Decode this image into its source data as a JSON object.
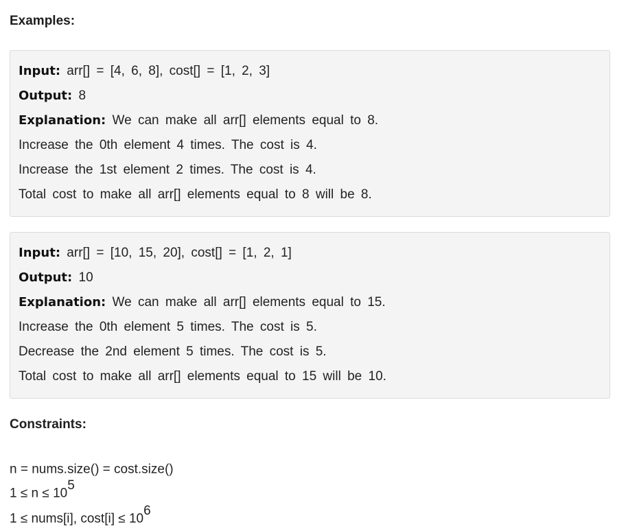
{
  "examples_heading": "Examples:",
  "examples": [
    {
      "input_label": "Input:",
      "input_value": "arr[] = [4, 6, 8], cost[] = [1, 2, 3]",
      "output_label": "Output:",
      "output_value": "8",
      "explanation_label": "Explanation:",
      "explanation_value": "We can make all arr[] elements equal to 8.",
      "details": [
        "Increase the 0th element 4 times. The cost is 4.",
        "Increase the 1st element 2 times. The cost is 4.",
        "Total cost to make all arr[] elements equal to 8 will be 8."
      ]
    },
    {
      "input_label": "Input:",
      "input_value": "arr[] = [10, 15, 20], cost[] = [1, 2, 1]",
      "output_label": "Output:",
      "output_value": "10",
      "explanation_label": "Explanation:",
      "explanation_value": "We can make all arr[] elements equal to 15.",
      "details": [
        "Increase the 0th element 5 times. The cost is 5.",
        "Decrease the 2nd element 5 times. The cost is 5.",
        "Total cost to make all arr[] elements equal to 15 will be 10."
      ]
    }
  ],
  "constraints_heading": "Constraints:",
  "constraints": [
    {
      "text": "n = nums.size() = cost.size()",
      "sup": ""
    },
    {
      "text": "1 ≤ n ≤ 10",
      "sup": "5"
    },
    {
      "text": "1 ≤ nums[i], cost[i] ≤ 10",
      "sup": "6"
    }
  ]
}
